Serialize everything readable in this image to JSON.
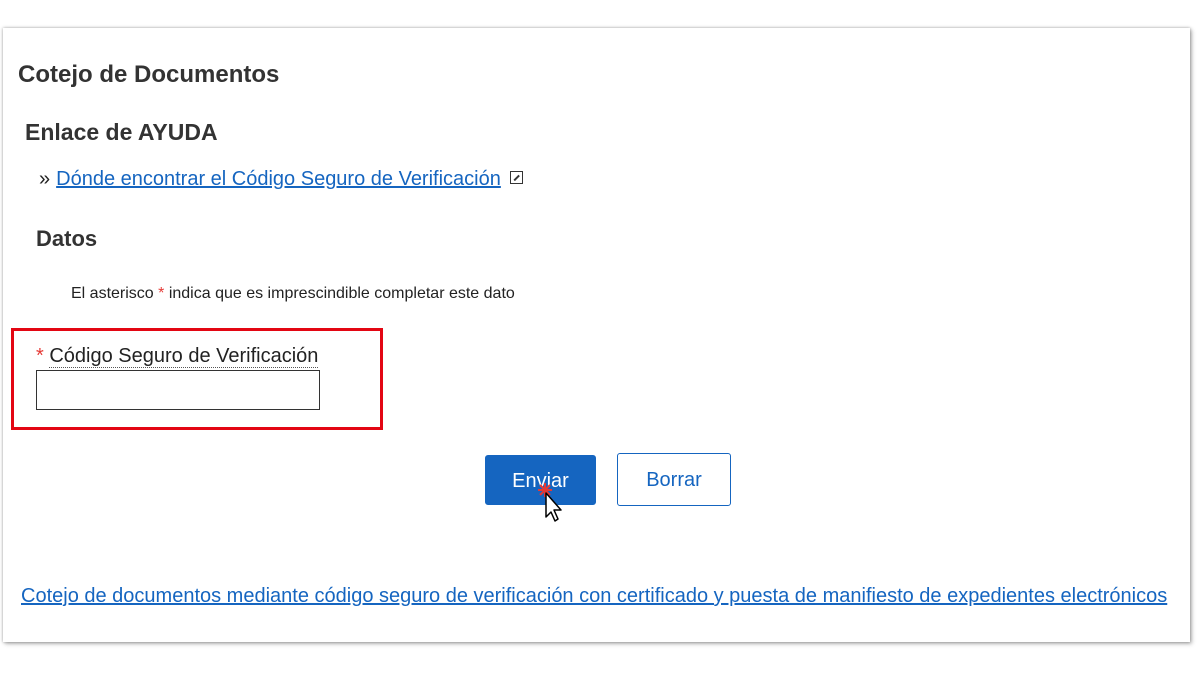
{
  "page_title": "Cotejo de Documentos",
  "help_section": {
    "heading": "Enlace de AYUDA",
    "bullet": "»",
    "link_text": "Dónde encontrar el Código Seguro de Verificación"
  },
  "data_section": {
    "heading": "Datos",
    "note_before": "El asterisco ",
    "note_asterisk": "*",
    "note_after": " indica que es imprescindible completar este dato"
  },
  "csv_field": {
    "required_mark": "*",
    "label": "Código Seguro de Verificación",
    "value": "",
    "highlight_color": "#e30613"
  },
  "buttons": {
    "submit_label": "Enviar",
    "clear_label": "Borrar"
  },
  "footer": {
    "link_text": "Cotejo de documentos mediante código seguro de verificación con certificado y puesta de manifiesto de expedientes electrónicos"
  },
  "colors": {
    "link": "#1565c0",
    "primary_button": "#1565c0",
    "required": "#e53935"
  },
  "icons": {
    "external_link": "external-link-icon",
    "cursor": "pointer-cursor-icon"
  }
}
